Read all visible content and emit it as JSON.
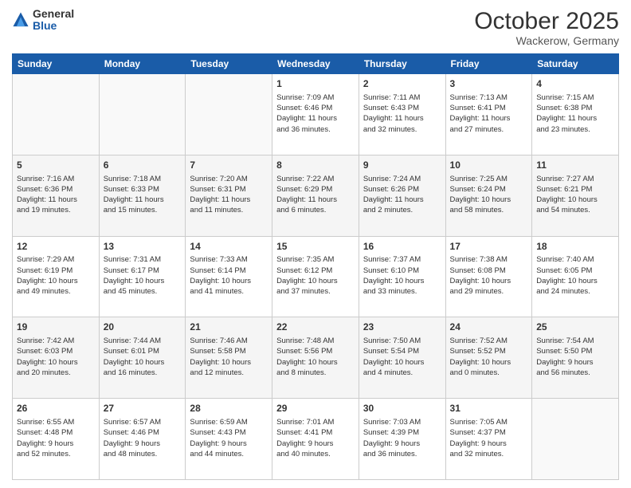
{
  "logo": {
    "general": "General",
    "blue": "Blue"
  },
  "header": {
    "month": "October 2025",
    "location": "Wackerow, Germany"
  },
  "days": [
    "Sunday",
    "Monday",
    "Tuesday",
    "Wednesday",
    "Thursday",
    "Friday",
    "Saturday"
  ],
  "weeks": [
    [
      {
        "num": "",
        "lines": []
      },
      {
        "num": "",
        "lines": []
      },
      {
        "num": "",
        "lines": []
      },
      {
        "num": "1",
        "lines": [
          "Sunrise: 7:09 AM",
          "Sunset: 6:46 PM",
          "Daylight: 11 hours",
          "and 36 minutes."
        ]
      },
      {
        "num": "2",
        "lines": [
          "Sunrise: 7:11 AM",
          "Sunset: 6:43 PM",
          "Daylight: 11 hours",
          "and 32 minutes."
        ]
      },
      {
        "num": "3",
        "lines": [
          "Sunrise: 7:13 AM",
          "Sunset: 6:41 PM",
          "Daylight: 11 hours",
          "and 27 minutes."
        ]
      },
      {
        "num": "4",
        "lines": [
          "Sunrise: 7:15 AM",
          "Sunset: 6:38 PM",
          "Daylight: 11 hours",
          "and 23 minutes."
        ]
      }
    ],
    [
      {
        "num": "5",
        "lines": [
          "Sunrise: 7:16 AM",
          "Sunset: 6:36 PM",
          "Daylight: 11 hours",
          "and 19 minutes."
        ]
      },
      {
        "num": "6",
        "lines": [
          "Sunrise: 7:18 AM",
          "Sunset: 6:33 PM",
          "Daylight: 11 hours",
          "and 15 minutes."
        ]
      },
      {
        "num": "7",
        "lines": [
          "Sunrise: 7:20 AM",
          "Sunset: 6:31 PM",
          "Daylight: 11 hours",
          "and 11 minutes."
        ]
      },
      {
        "num": "8",
        "lines": [
          "Sunrise: 7:22 AM",
          "Sunset: 6:29 PM",
          "Daylight: 11 hours",
          "and 6 minutes."
        ]
      },
      {
        "num": "9",
        "lines": [
          "Sunrise: 7:24 AM",
          "Sunset: 6:26 PM",
          "Daylight: 11 hours",
          "and 2 minutes."
        ]
      },
      {
        "num": "10",
        "lines": [
          "Sunrise: 7:25 AM",
          "Sunset: 6:24 PM",
          "Daylight: 10 hours",
          "and 58 minutes."
        ]
      },
      {
        "num": "11",
        "lines": [
          "Sunrise: 7:27 AM",
          "Sunset: 6:21 PM",
          "Daylight: 10 hours",
          "and 54 minutes."
        ]
      }
    ],
    [
      {
        "num": "12",
        "lines": [
          "Sunrise: 7:29 AM",
          "Sunset: 6:19 PM",
          "Daylight: 10 hours",
          "and 49 minutes."
        ]
      },
      {
        "num": "13",
        "lines": [
          "Sunrise: 7:31 AM",
          "Sunset: 6:17 PM",
          "Daylight: 10 hours",
          "and 45 minutes."
        ]
      },
      {
        "num": "14",
        "lines": [
          "Sunrise: 7:33 AM",
          "Sunset: 6:14 PM",
          "Daylight: 10 hours",
          "and 41 minutes."
        ]
      },
      {
        "num": "15",
        "lines": [
          "Sunrise: 7:35 AM",
          "Sunset: 6:12 PM",
          "Daylight: 10 hours",
          "and 37 minutes."
        ]
      },
      {
        "num": "16",
        "lines": [
          "Sunrise: 7:37 AM",
          "Sunset: 6:10 PM",
          "Daylight: 10 hours",
          "and 33 minutes."
        ]
      },
      {
        "num": "17",
        "lines": [
          "Sunrise: 7:38 AM",
          "Sunset: 6:08 PM",
          "Daylight: 10 hours",
          "and 29 minutes."
        ]
      },
      {
        "num": "18",
        "lines": [
          "Sunrise: 7:40 AM",
          "Sunset: 6:05 PM",
          "Daylight: 10 hours",
          "and 24 minutes."
        ]
      }
    ],
    [
      {
        "num": "19",
        "lines": [
          "Sunrise: 7:42 AM",
          "Sunset: 6:03 PM",
          "Daylight: 10 hours",
          "and 20 minutes."
        ]
      },
      {
        "num": "20",
        "lines": [
          "Sunrise: 7:44 AM",
          "Sunset: 6:01 PM",
          "Daylight: 10 hours",
          "and 16 minutes."
        ]
      },
      {
        "num": "21",
        "lines": [
          "Sunrise: 7:46 AM",
          "Sunset: 5:58 PM",
          "Daylight: 10 hours",
          "and 12 minutes."
        ]
      },
      {
        "num": "22",
        "lines": [
          "Sunrise: 7:48 AM",
          "Sunset: 5:56 PM",
          "Daylight: 10 hours",
          "and 8 minutes."
        ]
      },
      {
        "num": "23",
        "lines": [
          "Sunrise: 7:50 AM",
          "Sunset: 5:54 PM",
          "Daylight: 10 hours",
          "and 4 minutes."
        ]
      },
      {
        "num": "24",
        "lines": [
          "Sunrise: 7:52 AM",
          "Sunset: 5:52 PM",
          "Daylight: 10 hours",
          "and 0 minutes."
        ]
      },
      {
        "num": "25",
        "lines": [
          "Sunrise: 7:54 AM",
          "Sunset: 5:50 PM",
          "Daylight: 9 hours",
          "and 56 minutes."
        ]
      }
    ],
    [
      {
        "num": "26",
        "lines": [
          "Sunrise: 6:55 AM",
          "Sunset: 4:48 PM",
          "Daylight: 9 hours",
          "and 52 minutes."
        ]
      },
      {
        "num": "27",
        "lines": [
          "Sunrise: 6:57 AM",
          "Sunset: 4:46 PM",
          "Daylight: 9 hours",
          "and 48 minutes."
        ]
      },
      {
        "num": "28",
        "lines": [
          "Sunrise: 6:59 AM",
          "Sunset: 4:43 PM",
          "Daylight: 9 hours",
          "and 44 minutes."
        ]
      },
      {
        "num": "29",
        "lines": [
          "Sunrise: 7:01 AM",
          "Sunset: 4:41 PM",
          "Daylight: 9 hours",
          "and 40 minutes."
        ]
      },
      {
        "num": "30",
        "lines": [
          "Sunrise: 7:03 AM",
          "Sunset: 4:39 PM",
          "Daylight: 9 hours",
          "and 36 minutes."
        ]
      },
      {
        "num": "31",
        "lines": [
          "Sunrise: 7:05 AM",
          "Sunset: 4:37 PM",
          "Daylight: 9 hours",
          "and 32 minutes."
        ]
      },
      {
        "num": "",
        "lines": []
      }
    ]
  ]
}
